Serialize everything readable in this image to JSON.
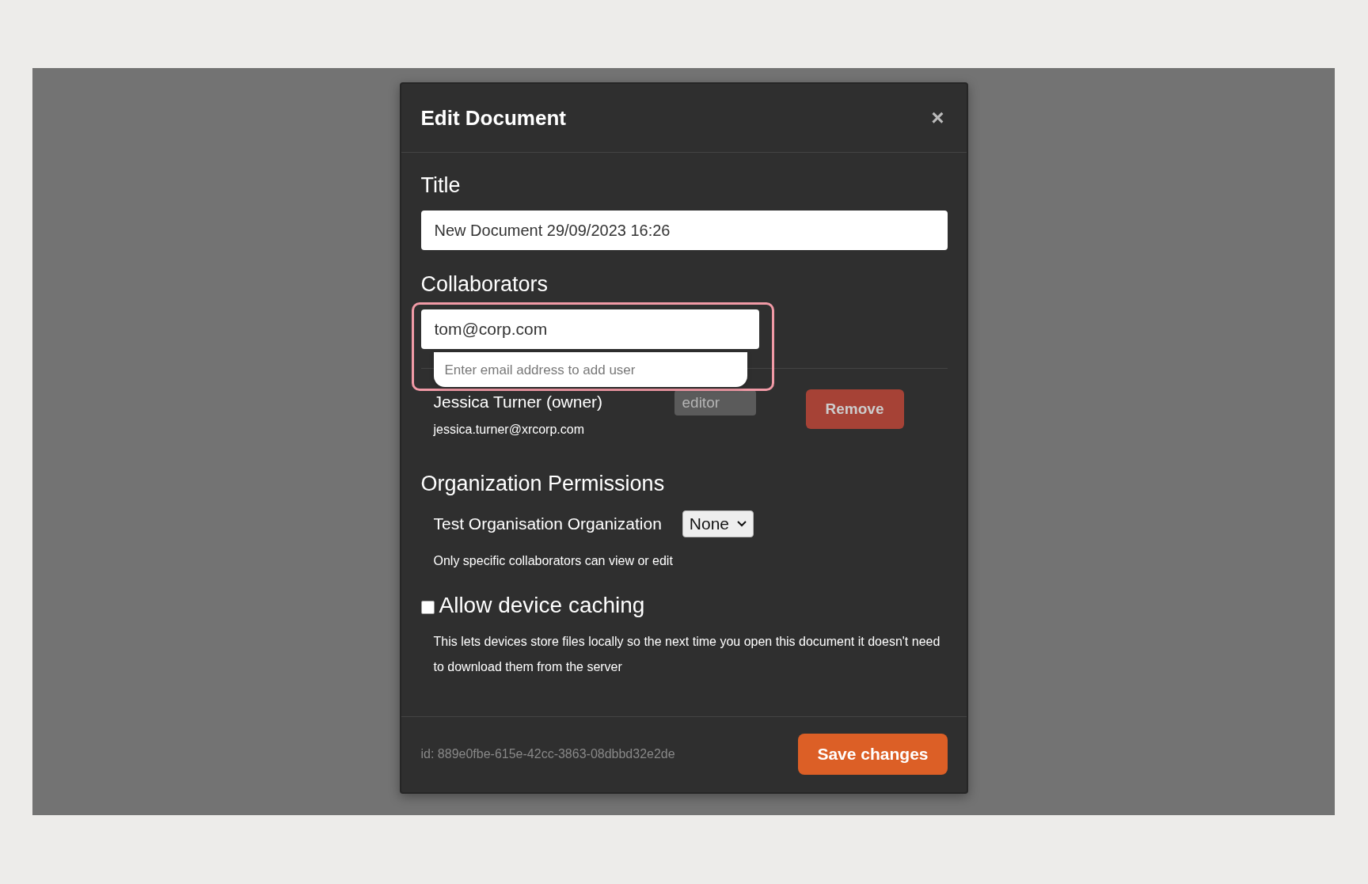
{
  "dialog": {
    "title": "Edit Document",
    "close": "×"
  },
  "title_section": {
    "label": "Title",
    "value": "New Document 29/09/2023 16:26"
  },
  "collaborators": {
    "label": "Collaborators",
    "input_value": "tom@corp.com",
    "focused": true,
    "hint": "Enter email address to add user",
    "users": [
      {
        "name": "Jessica Turner (owner)",
        "email": "jessica.turner@xrcorp.com",
        "role": "editor",
        "role_disabled": true,
        "remove": "Remove"
      }
    ]
  },
  "organization": {
    "label": "Organization Permissions",
    "name": "Test Organisation Organization",
    "permission": "None",
    "description": "Only specific collaborators can view or edit"
  },
  "caching": {
    "label": "Allow device caching",
    "checked": false,
    "description": "This lets devices store files locally so the next time you open this document it doesn't need to download them from the server"
  },
  "footer": {
    "id": "id: 889e0fbe-615e-42cc-3863-08dbbd32e2de",
    "save": "Save changes"
  }
}
